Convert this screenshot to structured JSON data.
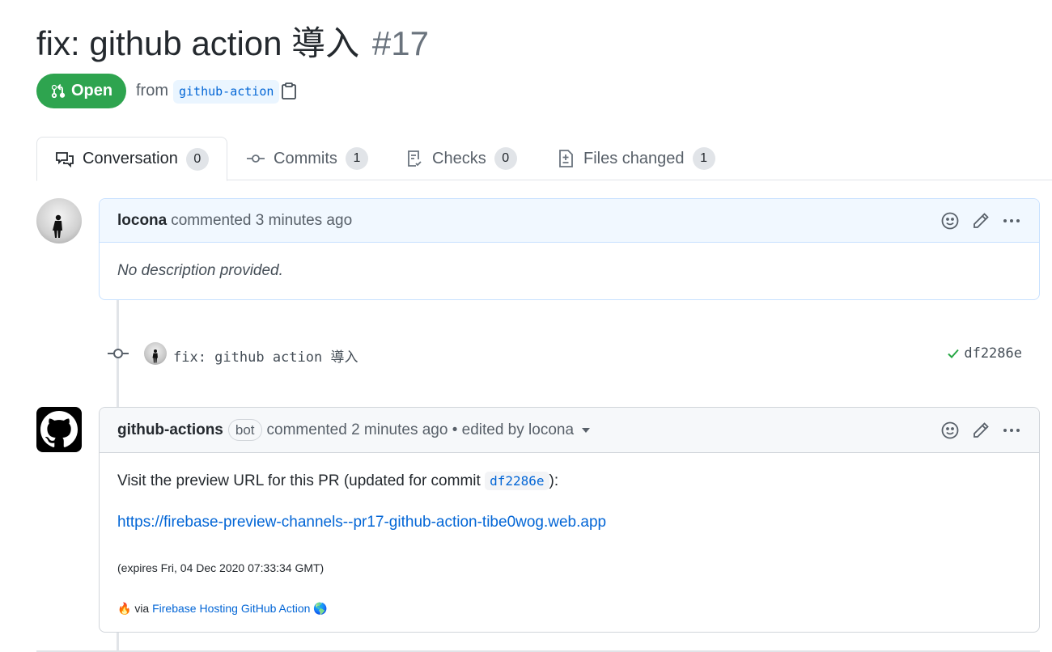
{
  "pr": {
    "title": "fix: github action 導入",
    "number": "#17",
    "state": "Open",
    "from_text": "from",
    "branch": "github-action"
  },
  "tabs": [
    {
      "label": "Conversation",
      "count": "0"
    },
    {
      "label": "Commits",
      "count": "1"
    },
    {
      "label": "Checks",
      "count": "0"
    },
    {
      "label": "Files changed",
      "count": "1"
    }
  ],
  "comment1": {
    "author": "locona",
    "meta": "commented 3 minutes ago",
    "body": "No description provided."
  },
  "commit": {
    "message": "fix: github action 導入",
    "sha": "df2286e"
  },
  "comment2": {
    "author": "github-actions",
    "bot_label": "bot",
    "meta": "commented 2 minutes ago • edited by locona",
    "line1_before": "Visit the preview URL for this PR (updated for commit ",
    "line1_sha": "df2286e",
    "line1_after": "):",
    "preview_url": "https://firebase-preview-channels--pr17-github-action-tibe0wog.web.app",
    "expires": "(expires Fri, 04 Dec 2020 07:33:34 GMT)",
    "via_prefix": "🔥 via ",
    "via_link": "Firebase Hosting GitHub Action",
    "via_suffix": " 🌎"
  },
  "colors": {
    "open_green": "#2ea44f",
    "link_blue": "#0366d6",
    "check_green": "#28a745"
  }
}
